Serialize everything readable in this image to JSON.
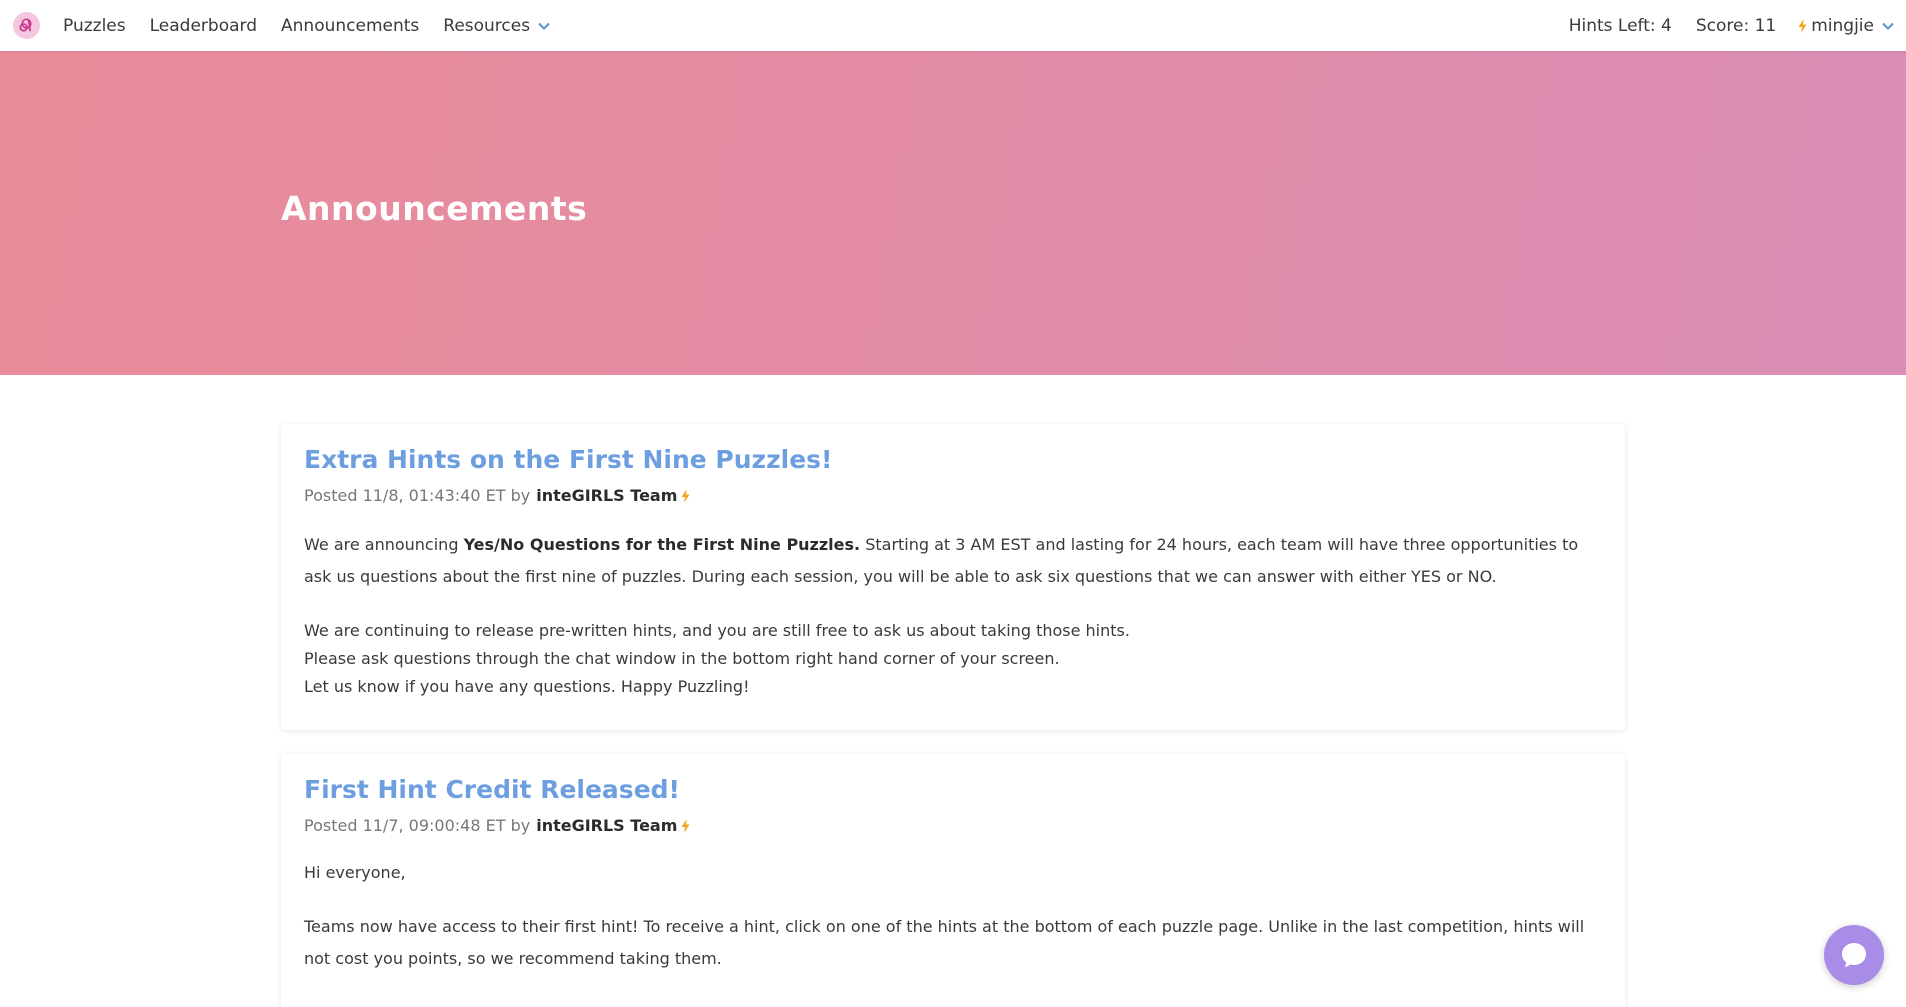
{
  "nav": {
    "items": [
      {
        "label": "Puzzles"
      },
      {
        "label": "Leaderboard"
      },
      {
        "label": "Announcements"
      },
      {
        "label": "Resources"
      }
    ],
    "hints_left": "Hints Left: 4",
    "score": "Score: 11",
    "username": "mingjie"
  },
  "hero": {
    "title": "Announcements"
  },
  "announcements": [
    {
      "title": "Extra Hints on the First Nine Puzzles!",
      "posted": "Posted 11/8, 01:43:40 ET by",
      "author": "inteGIRLS Team",
      "p1_pre": "We are announcing ",
      "p1_bold": "Yes/No Questions for the First Nine Puzzles.",
      "p1_post": " Starting at 3 AM EST and lasting for 24 hours, each team will have three opportunities to ask us questions about the first nine of puzzles. During each session, you will be able to ask six questions that we can answer with either YES or NO.",
      "line1": "We are continuing to release pre-written hints, and you are still free to ask us about taking those hints.",
      "line2": "Please ask questions through the chat window in the bottom right hand corner of your screen.",
      "line3": "Let us know if you have any questions. Happy Puzzling!"
    },
    {
      "title": "First Hint Credit Released!",
      "posted": "Posted 11/7, 09:00:48 ET by",
      "author": "inteGIRLS Team",
      "greeting": "Hi everyone,",
      "p1": "Teams now have access to their first hint! To receive a hint, click on one of the hints at the bottom of each puzzle page. Unlike in the last competition, hints will not cost you points, so we recommend taking them."
    }
  ],
  "colors": {
    "accent_link": "#6d9ee0",
    "hero_gradient_start": "#e98b98",
    "hero_gradient_end": "#da8db5",
    "bolt": "#f5a623",
    "chat_button": "#a98be8",
    "logo_bg": "#f5c6e0"
  },
  "icons": {
    "logo": "integirls-logo-icon",
    "dropdown": "chevron-down-icon",
    "bolt": "lightning-bolt-icon",
    "chat": "chat-bubble-icon"
  }
}
